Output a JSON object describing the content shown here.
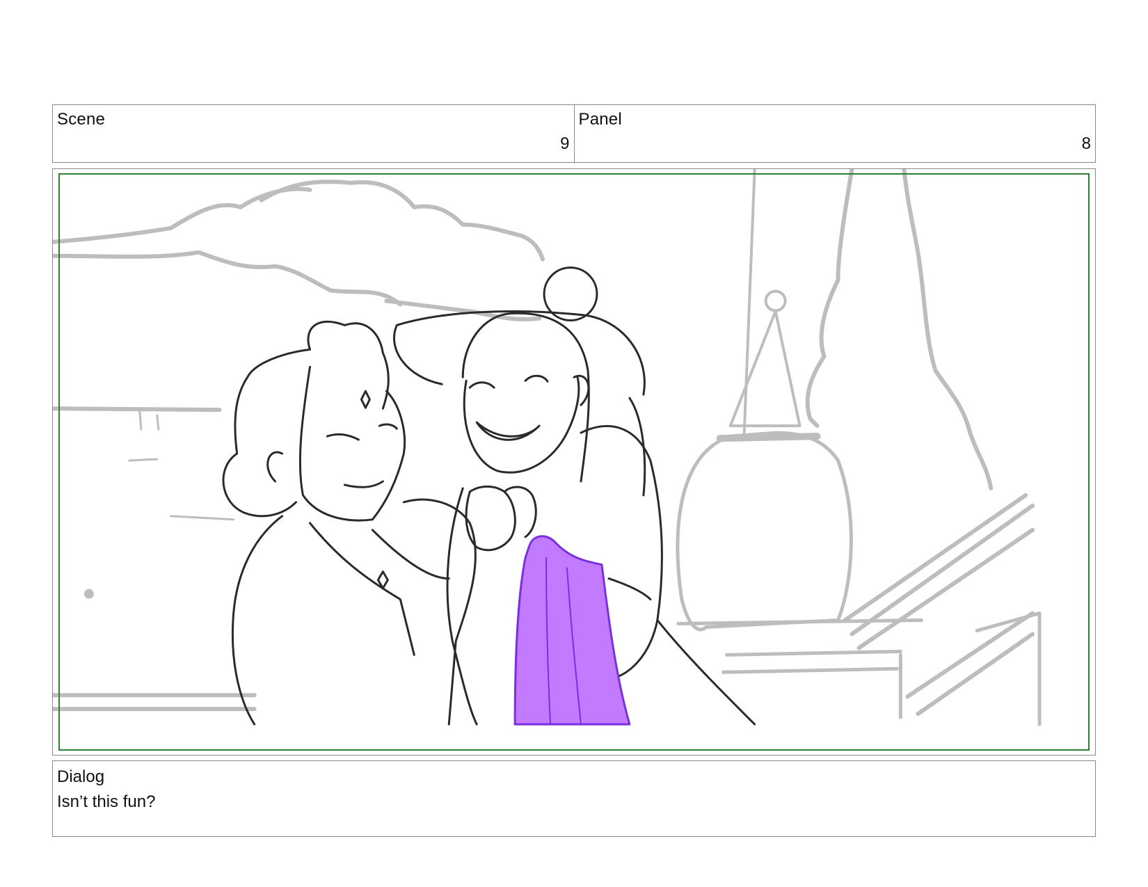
{
  "header": {
    "scene_label": "Scene",
    "scene_number": "9",
    "panel_label": "Panel",
    "panel_number": "8"
  },
  "frame": {
    "illustration": "storyboard-sketch",
    "safe_area_color": "#2e7d32",
    "accent_color": "#c27bff"
  },
  "dialog": {
    "label": "Dialog",
    "text": "Isn’t this fun?"
  }
}
